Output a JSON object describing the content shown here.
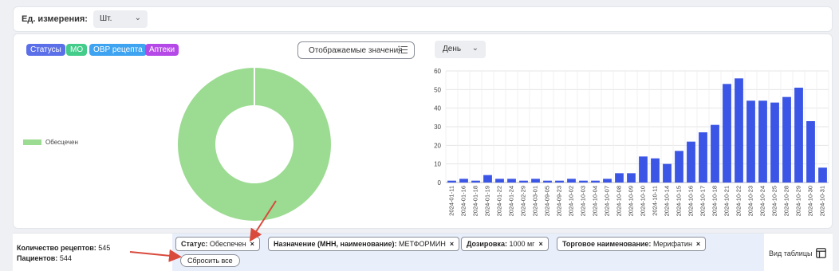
{
  "unit": {
    "label": "Ед. измерения:",
    "value": "Шт."
  },
  "chips": [
    "Статусы",
    "МО",
    "ОВР рецепта",
    "Аптеки"
  ],
  "display_button": "Отображаемые значения",
  "period": "День",
  "legend": {
    "label": "Обесцечен",
    "color": "#9cdb92"
  },
  "colors": {
    "bar": "#3b55e6",
    "donut": "#9cdb92",
    "arrow": "#d94a3d"
  },
  "chart_data": [
    {
      "type": "pie",
      "categories": [
        "Обесцечен"
      ],
      "values": [
        100
      ],
      "donut": true
    },
    {
      "type": "bar",
      "categories": [
        "2024-01-11",
        "2024-01-16",
        "2024-01-18",
        "2024-01-19",
        "2024-01-22",
        "2024-01-24",
        "2024-02-29",
        "2024-03-01",
        "2024-09-05",
        "2024-09-23",
        "2024-10-02",
        "2024-10-03",
        "2024-10-04",
        "2024-10-07",
        "2024-10-08",
        "2024-10-09",
        "2024-10-10",
        "2024-10-11",
        "2024-10-14",
        "2024-10-15",
        "2024-10-16",
        "2024-10-17",
        "2024-10-18",
        "2024-10-21",
        "2024-10-22",
        "2024-10-23",
        "2024-10-24",
        "2024-10-25",
        "2024-10-28",
        "2024-10-29",
        "2024-10-30",
        "2024-10-31"
      ],
      "values": [
        1,
        2,
        1,
        4,
        2,
        2,
        1,
        2,
        1,
        1,
        2,
        1,
        1,
        2,
        5,
        5,
        14,
        13,
        10,
        17,
        22,
        27,
        31,
        53,
        56,
        44,
        44,
        43,
        46,
        51,
        33,
        8
      ],
      "ylim": [
        0,
        60
      ],
      "yticks": [
        0,
        10,
        20,
        30,
        40,
        50,
        60
      ],
      "grid": true
    }
  ],
  "stats": {
    "recipes_label": "Количество рецептов:",
    "recipes_value": "545",
    "patients_label": "Пациентов:",
    "patients_value": "544"
  },
  "filters": [
    {
      "key": "Статус:",
      "value": "Обеспечен"
    },
    {
      "key": "Назначение (МНН, наименование):",
      "value": "МЕТФОРМИН"
    },
    {
      "key": "Дозировка:",
      "value": "1000 мг"
    },
    {
      "key": "Торговое наименование:",
      "value": "Мерифатин"
    }
  ],
  "remove_icon": "×",
  "reset_label": "Сбросить все",
  "table_view_label": "Вид таблицы"
}
